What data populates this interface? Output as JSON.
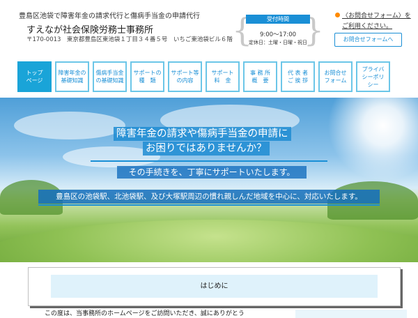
{
  "header": {
    "tagline": "豊島区池袋で障害年金の請求代行と傷病手当金の申請代行",
    "firm_name": "すえなが社会保険労務士事務所",
    "address": "〒170-0013　東京都豊島区東池袋１丁目３４番５号　いちご東池袋ビル６階",
    "hours_title": "受付時間",
    "hours_time": "9:00〜17:00",
    "hours_closed": "定休日：土曜・日曜・祝日",
    "contact_link_line1": "〈お問合せフォーム〉を",
    "contact_link_line2": "ご利用ください。",
    "contact_button": "お問合せフォームへ"
  },
  "nav": {
    "items": [
      {
        "label": "トップ\nページ",
        "active": true
      },
      {
        "label": "障害年金の\n基礎知識",
        "active": false
      },
      {
        "label": "傷病手当金\nの基礎知識",
        "active": false
      },
      {
        "label": "サポートの\n種　類",
        "active": false
      },
      {
        "label": "サポート等\nの内容",
        "active": false
      },
      {
        "label": "サポート\n料　金",
        "active": false
      },
      {
        "label": "事 務 所\n概　要",
        "active": false
      },
      {
        "label": "代 表 者\nご 挨 拶",
        "active": false
      },
      {
        "label": "お問合せ\nフォーム",
        "active": false
      },
      {
        "label": "プライバ\nシーポリ\nシー",
        "active": false
      }
    ]
  },
  "hero": {
    "line1": "障害年金の請求や傷病手当金の申請に",
    "line2": "お困りではありませんか？",
    "line3": "その手続きを、丁寧にサポートいたします。",
    "line4": "豊島区の池袋駅、北池袋駅、及び大塚駅周辺の慣れ親しんだ地域を中心に、対応いたします。"
  },
  "content": {
    "intro_heading": "はじめに",
    "intro_text": "この度は、当事務所のホームページをご訪問いただき、誠にありがとう"
  },
  "colors": {
    "accent": "#1a8fd6",
    "nav_border": "#6cc6e8",
    "nav_active": "#1aa4d8",
    "contact_dot": "#ff8a00",
    "intro_bg": "#dff2fb"
  }
}
